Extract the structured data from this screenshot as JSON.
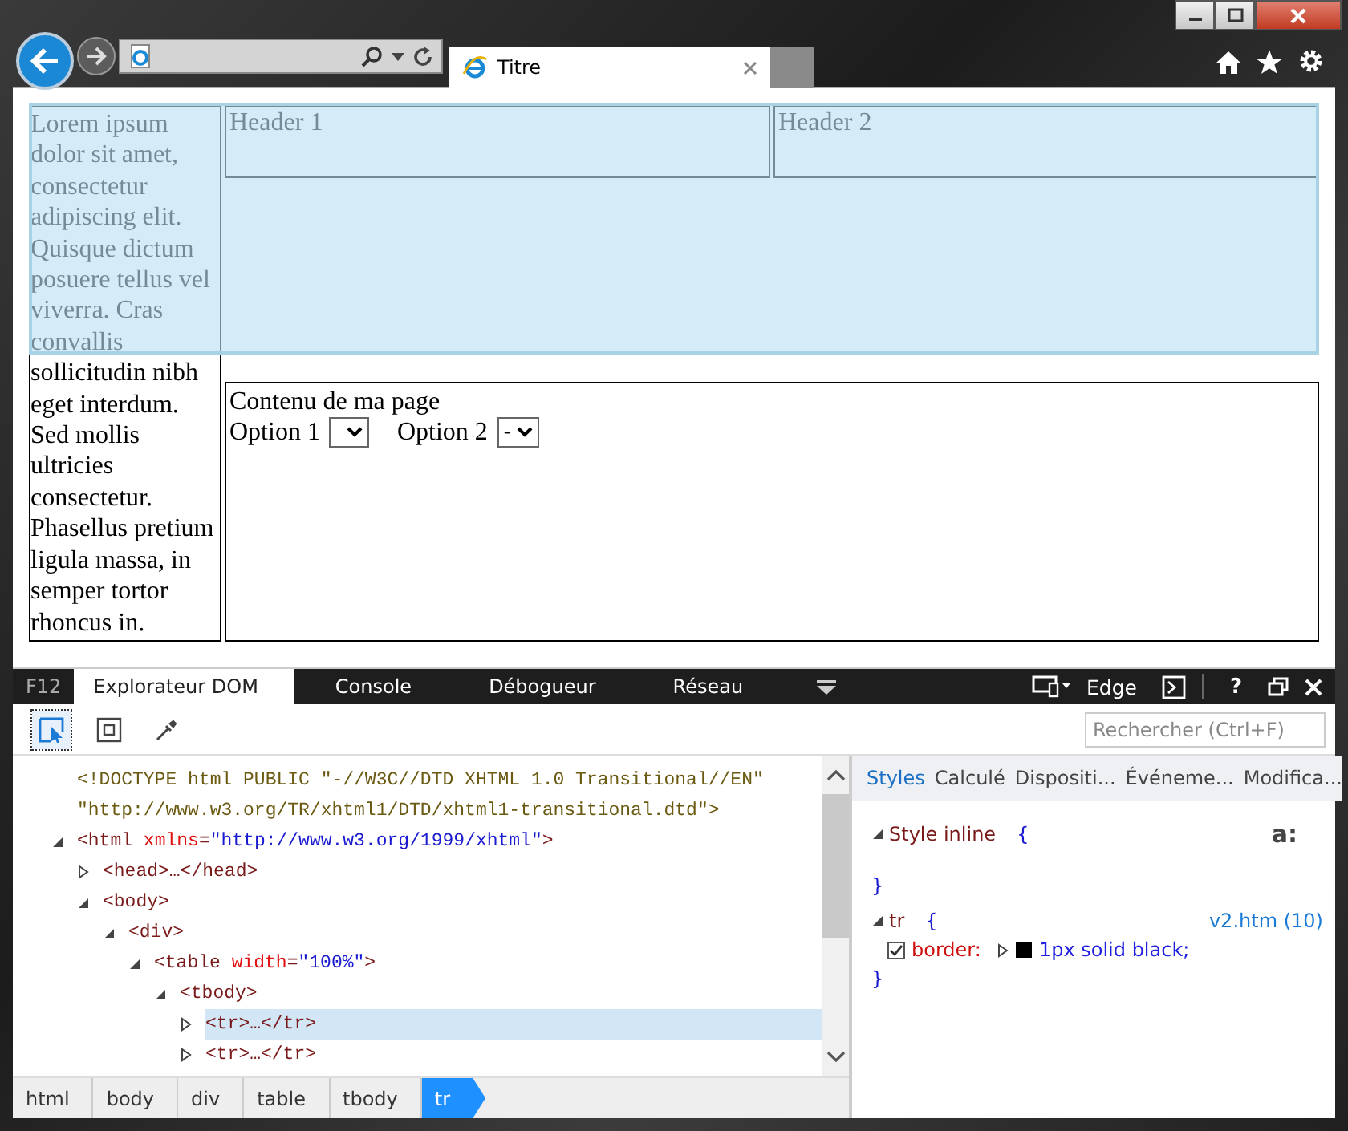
{
  "window": {
    "controls": [
      {
        "kind": "minimize"
      },
      {
        "kind": "maximize"
      },
      {
        "kind": "close"
      }
    ]
  },
  "browser": {
    "tabs": [
      {
        "title": "Titre",
        "selected": true
      }
    ]
  },
  "page": {
    "side_text": "Lorem ipsum dolor sit amet, consectetur adipiscing elit. Quisque dictum posuere tellus vel viverra. Cras convallis sollicitudin nibh eget interdum. Sed mollis ultricies consectetur. Phasellus pretium ligula massa, in semper tortor rhoncus in.",
    "header_row": {
      "highlighted": true,
      "cells": [
        "Header 1",
        "Header 2"
      ]
    },
    "content_row": {
      "highlighted": false,
      "title": "Contenu de ma page",
      "options": [
        {
          "label": "Option 1"
        },
        {
          "label": "Option 2",
          "value": "-"
        }
      ]
    }
  },
  "devtools": {
    "label": "F12",
    "tabs": [
      {
        "label": "Explorateur DOM",
        "selected": true
      },
      {
        "label": "Console",
        "selected": false
      },
      {
        "label": "Débogueur",
        "selected": false
      },
      {
        "label": "Réseau",
        "selected": false
      }
    ],
    "emulation": "Edge",
    "help": "?",
    "tools": [
      {
        "kind": "select",
        "selected": true
      },
      {
        "kind": "box",
        "selected": false
      },
      {
        "kind": "picker",
        "selected": false
      }
    ],
    "search": {
      "placeholder": "Rechercher (Ctrl+F)"
    },
    "dom_tree": [
      {
        "kind": "doctype",
        "parts": [
          {
            "kind": "doctype",
            "text": "<!DOCTYPE html PUBLIC \"-//W3C//DTD XHTML 1.0 Transitional//EN\" \"http://www.w3.org/TR/xhtml1/DTD/xhtml1-transitional.dtd\">"
          }
        ]
      },
      {
        "kind": "element",
        "expanded": true,
        "selected": false,
        "parts": [
          {
            "kind": "tag",
            "text": "<html "
          },
          {
            "kind": "attr",
            "text": "xmlns"
          },
          {
            "kind": "punct",
            "text": "="
          },
          {
            "kind": "value",
            "text": "\"http://www.w3.org/1999/xhtml\""
          },
          {
            "kind": "tag",
            "text": ">"
          }
        ],
        "children": [
          {
            "kind": "element",
            "expanded": false,
            "selected": false,
            "parts": [
              {
                "kind": "tag",
                "text": "<head>…</head>"
              }
            ]
          },
          {
            "kind": "element",
            "expanded": true,
            "selected": false,
            "parts": [
              {
                "kind": "tag",
                "text": "<body>"
              }
            ],
            "children": [
              {
                "kind": "element",
                "expanded": true,
                "selected": false,
                "parts": [
                  {
                    "kind": "tag",
                    "text": "<div>"
                  }
                ],
                "children": [
                  {
                    "kind": "element",
                    "expanded": true,
                    "selected": false,
                    "parts": [
                      {
                        "kind": "tag",
                        "text": "<table "
                      },
                      {
                        "kind": "attr",
                        "text": "width"
                      },
                      {
                        "kind": "punct",
                        "text": "="
                      },
                      {
                        "kind": "value",
                        "text": "\"100%\""
                      },
                      {
                        "kind": "tag",
                        "text": ">"
                      }
                    ],
                    "children": [
                      {
                        "kind": "element",
                        "expanded": true,
                        "selected": false,
                        "parts": [
                          {
                            "kind": "tag",
                            "text": "<tbody>"
                          }
                        ],
                        "children": [
                          {
                            "kind": "element",
                            "expanded": false,
                            "selected": true,
                            "parts": [
                              {
                                "kind": "tag",
                                "text": "<tr>…</tr>"
                              }
                            ]
                          },
                          {
                            "kind": "element",
                            "expanded": false,
                            "selected": false,
                            "parts": [
                              {
                                "kind": "tag",
                                "text": "<tr>…</tr>"
                              }
                            ]
                          }
                        ]
                      }
                    ]
                  }
                ]
              }
            ]
          }
        ]
      }
    ],
    "breadcrumb": [
      {
        "label": "html",
        "selected": false
      },
      {
        "label": "body",
        "selected": false
      },
      {
        "label": "div",
        "selected": false
      },
      {
        "label": "table",
        "selected": false
      },
      {
        "label": "tbody",
        "selected": false
      },
      {
        "label": "tr",
        "selected": true
      }
    ],
    "style_tabs": [
      {
        "label": "Styles",
        "selected": true
      },
      {
        "label": "Calculé",
        "selected": false
      },
      {
        "label": "Dispositi...",
        "selected": false
      },
      {
        "label": "Événeme...",
        "selected": false
      },
      {
        "label": "Modifica...",
        "selected": false
      }
    ],
    "format_button": "a:",
    "rules": [
      {
        "selector": "Style inline",
        "open": "{",
        "close": "}",
        "expanded": true
      },
      {
        "selector": "tr",
        "open": "{",
        "close": "}",
        "source": "v2.htm (10)",
        "expanded": true,
        "declarations": [
          {
            "property": "border:",
            "value": "1px solid black;",
            "checked": true,
            "color": "#000000"
          }
        ]
      }
    ]
  }
}
